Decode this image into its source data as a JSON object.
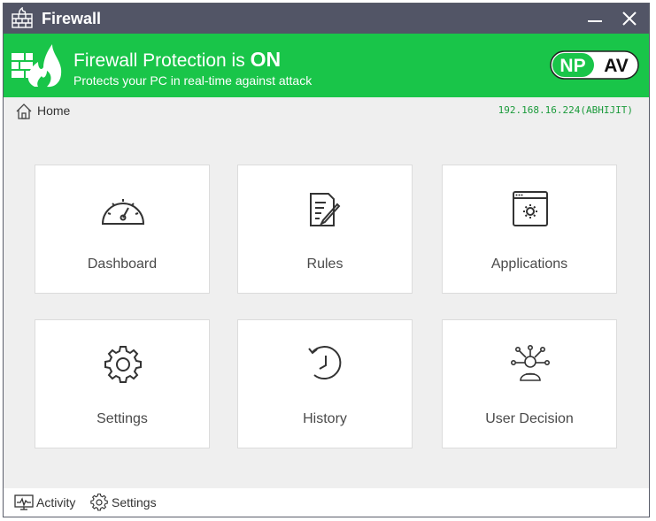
{
  "window": {
    "title": "Firewall",
    "icon": "firewall-icon",
    "controls": [
      "minimize-icon",
      "close-icon"
    ]
  },
  "banner": {
    "title_prefix": "Firewall Protection is ",
    "title_status": "ON",
    "subtitle": "Protects your PC in real-time against attack",
    "brand_left": "NP",
    "brand_right": "AV",
    "color": "#19c549"
  },
  "breadcrumb": {
    "label": "Home",
    "icon": "home-icon"
  },
  "ip_info": "192.168.16.224(ABHIJIT)",
  "tiles": [
    {
      "label": "Dashboard",
      "icon": "speedometer-icon"
    },
    {
      "label": "Rules",
      "icon": "document-edit-icon"
    },
    {
      "label": "Applications",
      "icon": "app-window-gear-icon"
    },
    {
      "label": "Settings",
      "icon": "gear-icon"
    },
    {
      "label": "History",
      "icon": "history-icon"
    },
    {
      "label": "User Decision",
      "icon": "user-decision-icon"
    }
  ],
  "footer": {
    "activity_label": "Activity",
    "settings_label": "Settings"
  }
}
